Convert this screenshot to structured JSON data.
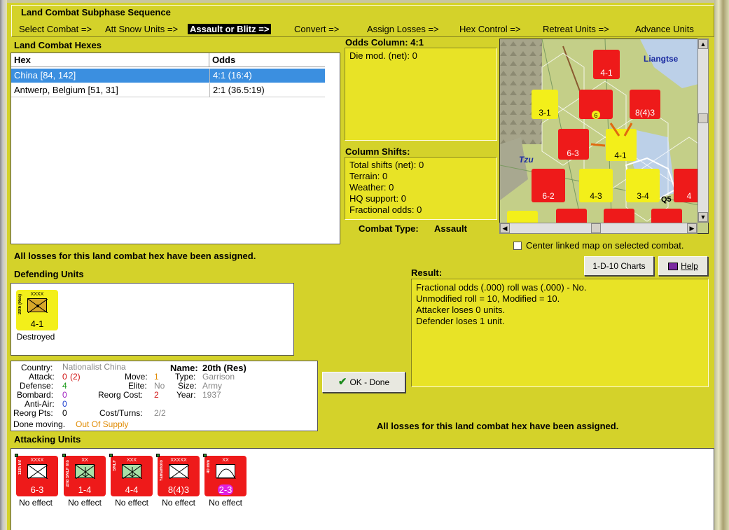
{
  "sequence": {
    "title": "Land Combat Subphase Sequence",
    "steps": [
      "Select Combat =>",
      "Att Snow Units =>",
      "Assault or Blitz =>",
      "Convert =>",
      "Assign Losses =>",
      "Hex Control =>",
      "Retreat Units =>",
      "Advance Units"
    ],
    "active_step": "Assault or Blitz =>"
  },
  "hexes": {
    "label": "Land Combat Hexes",
    "col_hex": "Hex",
    "col_odds": "Odds",
    "rows": [
      {
        "hex": "China [84, 142]",
        "odds": "4:1 (16:4)",
        "selected": true
      },
      {
        "hex": "Antwerp, Belgium [51, 31]",
        "odds": "2:1 (36.5:19)",
        "selected": false
      }
    ]
  },
  "odds": {
    "title": "Odds Column: 4:1",
    "die_mod": "Die mod. (net): 0"
  },
  "shifts": {
    "title": "Column Shifts:",
    "lines": [
      "Total shifts (net): 0",
      "Terrain: 0",
      "Weather: 0",
      "HQ support: 0",
      "Fractional odds: 0"
    ]
  },
  "combat_type": {
    "label": "Combat Type:",
    "value": "Assault"
  },
  "map": {
    "labels": [
      "Liangtse",
      "Tzu",
      "Q5"
    ],
    "counters": [
      "4-1",
      "3-1",
      "6",
      "8(4)3",
      "6-3",
      "4-1",
      "6-2",
      "4-3",
      "3-4",
      "4"
    ]
  },
  "center_linked": "Center linked map on selected combat.",
  "buttons": {
    "charts": "1-D-10 Charts",
    "help": "Help",
    "ok": "OK - Done"
  },
  "messages": {
    "losses_assigned": "All losses for this land combat hex have been assigned.",
    "losses_assigned_2": "All losses for this land combat hex have been assigned."
  },
  "defending": {
    "label": "Defending Units",
    "units": [
      {
        "name": "20th (Res)",
        "size": "XXXX",
        "strength": "4-1",
        "status": "Destroyed"
      }
    ]
  },
  "result": {
    "label": "Result:",
    "lines": [
      "Fractional odds (.000) roll was (.000)  - No.",
      "Unmodified roll = 10, Modified = 10.",
      "Attacker loses 0 units.",
      "Defender loses 1 unit."
    ]
  },
  "unit_info": {
    "country_label": "Country:",
    "country": "Nationalist China",
    "attack_label": "Attack:",
    "attack": "0",
    "attack_mod": "(2)",
    "defense_label": "Defense:",
    "defense": "4",
    "bombard_label": "Bombard:",
    "bombard": "0",
    "antiair_label": "Anti-Air:",
    "antiair": "0",
    "reorg_label": "Reorg Pts:",
    "reorg": "0",
    "done_moving": "Done moving.",
    "supply": "Out Of Supply",
    "move_label": "Move:",
    "move": "1",
    "elite_label": "Elite:",
    "elite": "No",
    "reorg_cost_label": "Reorg Cost:",
    "reorg_cost": "2",
    "cost_turns_label": "Cost/Turns:",
    "cost_turns": "2/2",
    "name_label": "Name:",
    "name": "20th (Res)",
    "type_label": "Type:",
    "type": "Garrison",
    "size_label": "Size:",
    "size": "Army",
    "year_label": "Year:",
    "year": "1937"
  },
  "attacking": {
    "label": "Attacking Units",
    "units": [
      {
        "name": "11th Inf",
        "size": "XXXX",
        "strength": "6-3",
        "status": "No effect"
      },
      {
        "name": "2nd SNLF Ins",
        "size": "XX",
        "strength": "1-4",
        "status": "No effect"
      },
      {
        "name": "SNLF",
        "size": "XXX",
        "strength": "4-4",
        "status": "No effect"
      },
      {
        "name": "Yamamoto",
        "size": "XXXXX",
        "strength": "8(4)3",
        "status": "No effect"
      },
      {
        "name": "40 mm",
        "size": "XX",
        "strength": "2-3",
        "status": "No effect"
      }
    ]
  },
  "colors": {
    "panel": "#d4d22a",
    "box": "#e8e326",
    "selected": "#3b8fe0"
  }
}
